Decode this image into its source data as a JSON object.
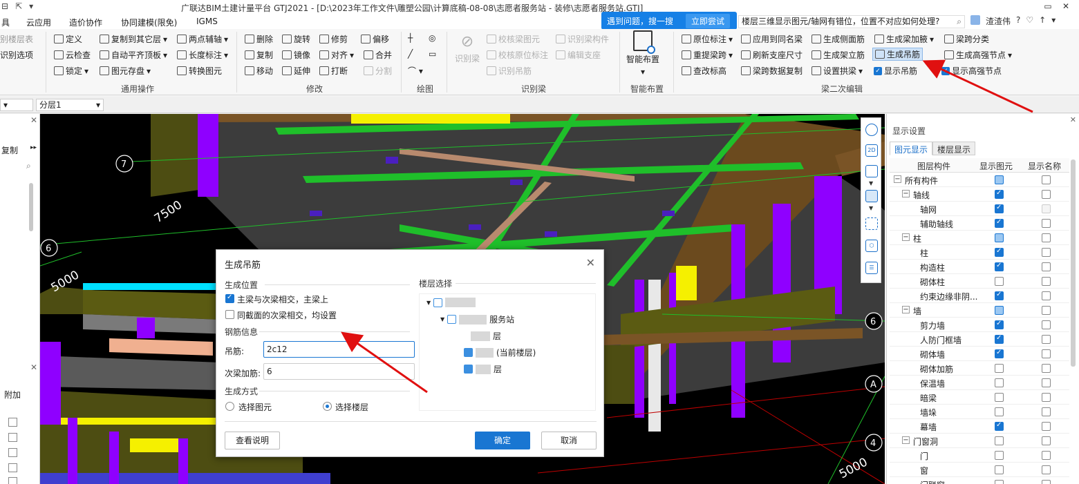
{
  "titlebar": {
    "title": "广联达BIM土建计量平台 GTJ2021 - [D:\\2023年工作文件\\雕塑公园\\计算底稿-08-08\\志愿者服务站 - 装修\\志愿者服务站.GTJ]",
    "quick_access": [
      "⊟",
      "⇱",
      "▾"
    ],
    "win_buttons": [
      "▭",
      "✕"
    ]
  },
  "menubar": {
    "items": [
      "具",
      "云应用",
      "造价协作",
      "协同建模(限免)",
      "IGMS"
    ]
  },
  "tip": {
    "text": "遇到问题，搜一搜",
    "try_label": "立即尝试"
  },
  "search": {
    "value": "楼层三维显示图元/轴网有错位，位置不对应如何处理?",
    "icon": "search-icon"
  },
  "user": {
    "name": "渣渣伟",
    "icons": [
      "?",
      "♡",
      "↑",
      "▾"
    ]
  },
  "ribbon": {
    "col0": [
      "别楼层表",
      "识别选项"
    ],
    "general": {
      "items": [
        "定义",
        "复制到其它层",
        "两点辅轴",
        "云检查",
        "自动平齐顶板",
        "长度标注",
        "锁定",
        "图元存盘",
        "转换图元"
      ],
      "label": "通用操作"
    },
    "modify": {
      "items": [
        "删除",
        "旋转",
        "修剪",
        "偏移",
        "复制",
        "镜像",
        "对齐",
        "合并",
        "移动",
        "延伸",
        "打断",
        "分割"
      ],
      "label": "修改"
    },
    "draw": {
      "label": "绘图"
    },
    "recognize": {
      "items": [
        "识别梁",
        "校核梁图元",
        "识别梁构件",
        "校核原位标注",
        "编辑支座",
        "识别吊筋"
      ],
      "label": "识别梁"
    },
    "smart": {
      "item": "智能布置",
      "label": "智能布置"
    },
    "beam2": {
      "items": [
        "原位标注",
        "应用到同名梁",
        "生成侧面筋",
        "生成梁加腋",
        "梁跨分类",
        "重提梁跨",
        "刷新支座尺寸",
        "生成架立筋",
        "生成吊筋",
        "生成高强节点",
        "查改标高",
        "梁跨数据复制",
        "设置拱梁",
        "显示吊筋",
        "显示高强节点"
      ],
      "label": "梁二次编辑"
    }
  },
  "floorbar": {
    "layer": "分层1"
  },
  "left_panel": {
    "copy_label": "复制",
    "attach_label": "附加"
  },
  "viewport": {
    "grid_labels": [
      "7",
      "6",
      "7500",
      "5000",
      "6",
      "A",
      "4",
      "5000"
    ]
  },
  "right_panel": {
    "title": "显示设置",
    "tabs": [
      "图元显示",
      "楼层显示"
    ],
    "headers": [
      "图层构件",
      "显示图元",
      "显示名称"
    ],
    "rows": [
      {
        "label": "所有构件",
        "level": 0,
        "toggle": "−",
        "c1": "part",
        "c2": "off"
      },
      {
        "label": "轴线",
        "level": 1,
        "toggle": "−",
        "c1": "on",
        "c2": "off"
      },
      {
        "label": "轴网",
        "level": 2,
        "c1": "on",
        "c2": "dim"
      },
      {
        "label": "辅助轴线",
        "level": 2,
        "c1": "on",
        "c2": "off"
      },
      {
        "label": "柱",
        "level": 1,
        "toggle": "−",
        "c1": "part",
        "c2": "off"
      },
      {
        "label": "柱",
        "level": 2,
        "c1": "on",
        "c2": "off"
      },
      {
        "label": "构造柱",
        "level": 2,
        "c1": "on",
        "c2": "off"
      },
      {
        "label": "砌体柱",
        "level": 2,
        "c1": "off",
        "c2": "off"
      },
      {
        "label": "约束边缘非阴...",
        "level": 2,
        "c1": "on",
        "c2": "off"
      },
      {
        "label": "墙",
        "level": 1,
        "toggle": "−",
        "c1": "part",
        "c2": "off"
      },
      {
        "label": "剪力墙",
        "level": 2,
        "c1": "on",
        "c2": "off"
      },
      {
        "label": "人防门框墙",
        "level": 2,
        "c1": "on",
        "c2": "off"
      },
      {
        "label": "砌体墙",
        "level": 2,
        "c1": "on",
        "c2": "off"
      },
      {
        "label": "砌体加筋",
        "level": 2,
        "c1": "off",
        "c2": "off"
      },
      {
        "label": "保温墙",
        "level": 2,
        "c1": "off",
        "c2": "off"
      },
      {
        "label": "暗梁",
        "level": 2,
        "c1": "off",
        "c2": "off"
      },
      {
        "label": "墙垛",
        "level": 2,
        "c1": "off",
        "c2": "off"
      },
      {
        "label": "幕墙",
        "level": 2,
        "c1": "on",
        "c2": "off"
      },
      {
        "label": "门窗洞",
        "level": 1,
        "toggle": "−",
        "c1": "off",
        "c2": "off"
      },
      {
        "label": "门",
        "level": 2,
        "c1": "off",
        "c2": "off"
      },
      {
        "label": "窗",
        "level": 2,
        "c1": "off",
        "c2": "off"
      },
      {
        "label": "门联窗",
        "level": 2,
        "c1": "off",
        "c2": "off"
      }
    ]
  },
  "dialog": {
    "title": "生成吊筋",
    "pos_section": "生成位置",
    "opt1": "主梁与次梁相交，主梁上",
    "opt2": "同截面的次梁相交，均设置",
    "rebar_section": "钢筋信息",
    "hanger_label": "吊筋:",
    "hanger_value": "2c12",
    "extra_label": "次梁加筋:",
    "extra_value": "6",
    "method_section": "生成方式",
    "method1": "选择图元",
    "method2": "选择楼层",
    "floor_section": "楼层选择",
    "tree": [
      "服务站",
      "层",
      "(当前楼层)",
      "层"
    ],
    "help_button": "查看说明",
    "ok_button": "确定",
    "cancel_button": "取消"
  }
}
